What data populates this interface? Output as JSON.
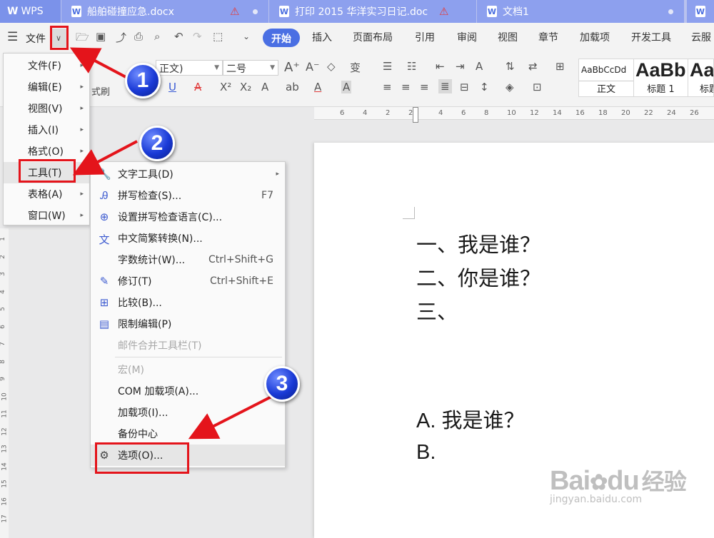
{
  "tabs": {
    "app": "WPS",
    "t1": "船舶碰撞应急.docx",
    "t2": "打印 2015 华洋实习日记.doc",
    "t3": "文档1"
  },
  "menubar": {
    "file": "文件",
    "tabs": [
      "开始",
      "插入",
      "页面布局",
      "引用",
      "审阅",
      "视图",
      "章节",
      "加载项",
      "开发工具",
      "云服"
    ]
  },
  "ribbon": {
    "font_name": "正文)",
    "font_size": "二号",
    "format_painter": "式刷",
    "styles": [
      {
        "sample": "AaBbCcDd",
        "name": "正文"
      },
      {
        "sample": "AaBb",
        "name": "标题 1"
      },
      {
        "sample": "AaI",
        "name": "标题"
      }
    ]
  },
  "ruler": [
    "6",
    "4",
    "2",
    "2",
    "4",
    "6",
    "8",
    "10",
    "12",
    "14",
    "16",
    "18",
    "20",
    "22",
    "24",
    "26"
  ],
  "vruler": [
    "1",
    "2",
    "3",
    "4",
    "5",
    "6",
    "7",
    "8",
    "9",
    "10",
    "11",
    "12",
    "13",
    "14",
    "15",
    "16",
    "17"
  ],
  "file_menu": [
    {
      "label": "文件(F)"
    },
    {
      "label": "编辑(E)"
    },
    {
      "label": "视图(V)"
    },
    {
      "label": "插入(I)"
    },
    {
      "label": "格式(O)"
    },
    {
      "label": "工具(T)"
    },
    {
      "label": "表格(A)"
    },
    {
      "label": "窗口(W)"
    }
  ],
  "tools_menu": [
    {
      "label": "文字工具(D)",
      "shortcut": ""
    },
    {
      "label": "拼写检查(S)...",
      "shortcut": "F7"
    },
    {
      "label": "设置拼写检查语言(C)...",
      "shortcut": ""
    },
    {
      "label": "中文简繁转换(N)...",
      "shortcut": ""
    },
    {
      "label": "字数统计(W)...",
      "shortcut": "Ctrl+Shift+G"
    },
    {
      "label": "修订(T)",
      "shortcut": "Ctrl+Shift+E"
    },
    {
      "label": "比较(B)...",
      "shortcut": ""
    },
    {
      "label": "限制编辑(P)",
      "shortcut": ""
    },
    {
      "label": "邮件合并工具栏(T)",
      "shortcut": ""
    },
    {
      "label": "宏(M)",
      "shortcut": ""
    },
    {
      "label": "COM 加载项(A)...",
      "shortcut": ""
    },
    {
      "label": "加载项(I)...",
      "shortcut": ""
    },
    {
      "label": "备份中心",
      "shortcut": ""
    },
    {
      "label": "选项(O)...",
      "shortcut": ""
    }
  ],
  "document": {
    "lines": [
      "一、我是谁？",
      "二、你是谁？",
      "三、",
      "A. 我是谁？",
      "B."
    ]
  },
  "badges": [
    "1",
    "2",
    "3"
  ],
  "watermark": {
    "brand": "Bai",
    "brand2": "du",
    "suffix": "经验",
    "url": "jingyan.baidu.com"
  }
}
